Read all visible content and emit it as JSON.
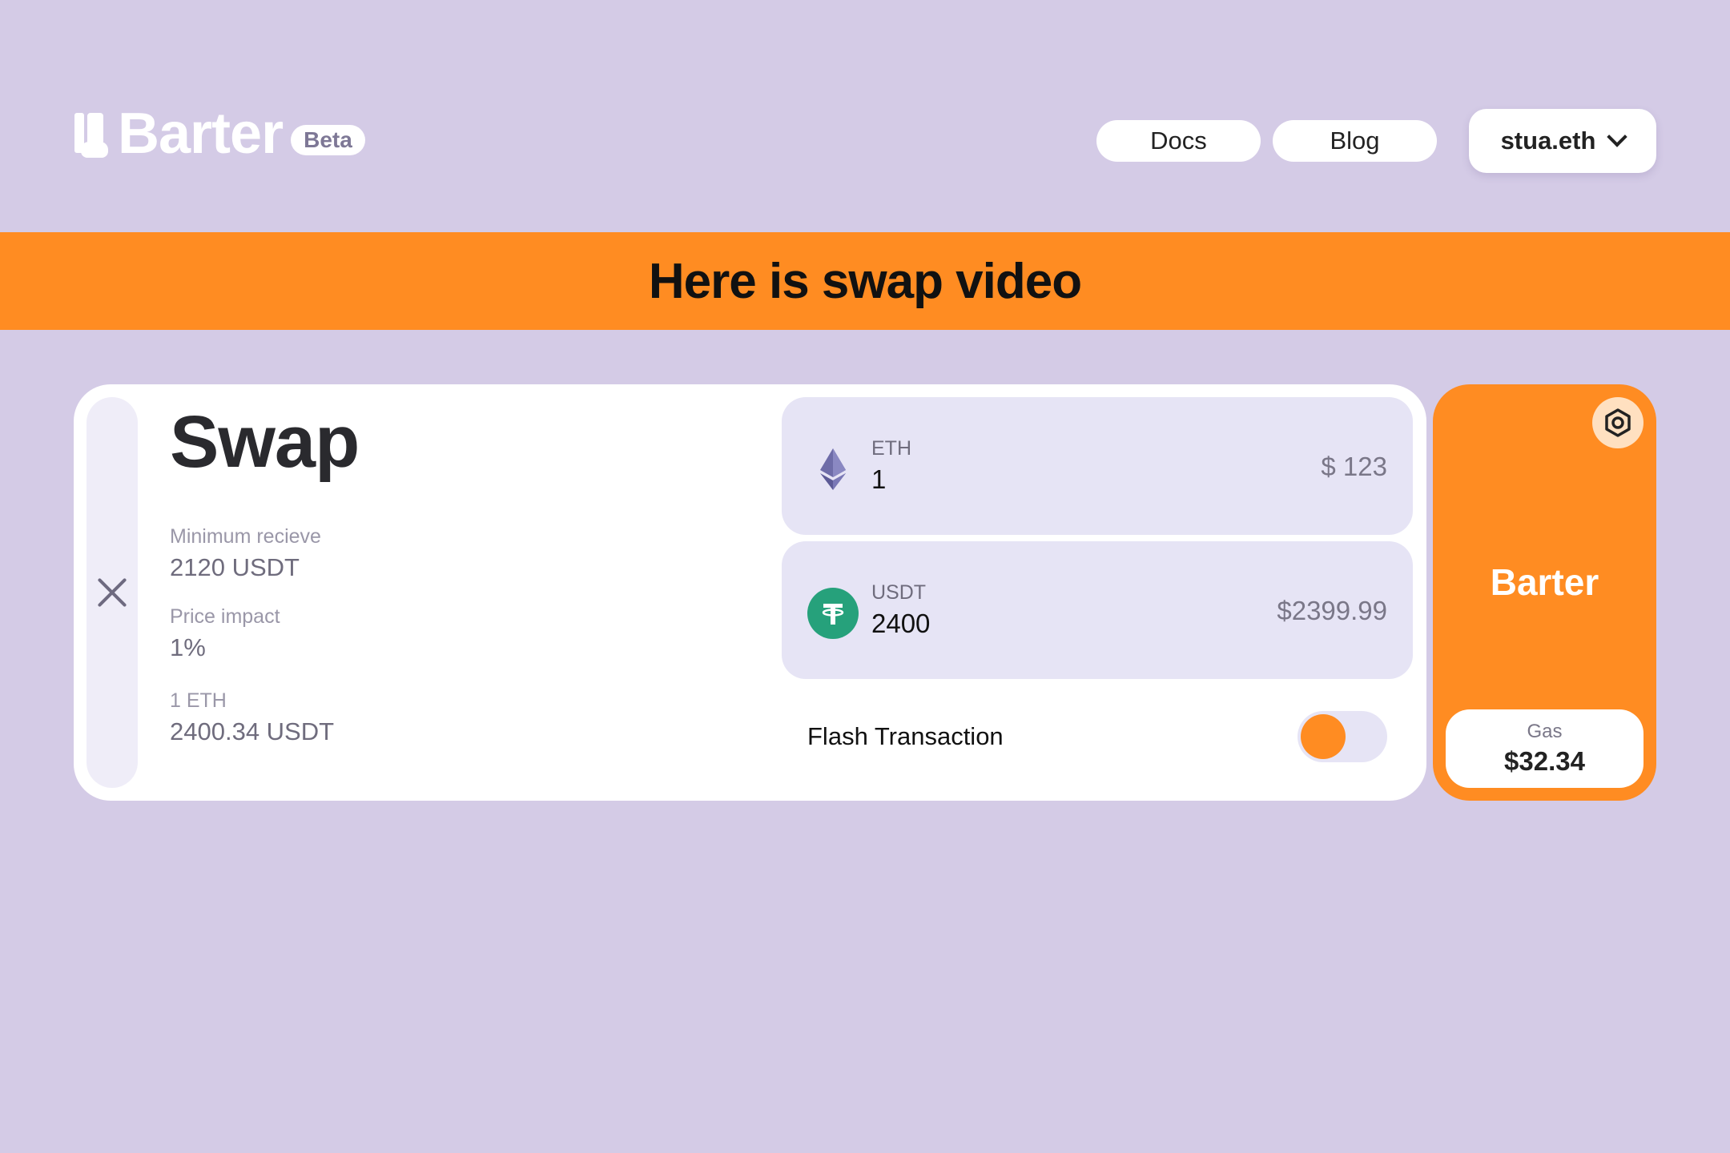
{
  "header": {
    "logo_text": "Barter",
    "beta_badge": "Beta",
    "nav": {
      "docs": "Docs",
      "blog": "Blog"
    },
    "account": "stua.eth"
  },
  "banner": {
    "title": "Here is swap video"
  },
  "swap": {
    "title": "Swap",
    "stats": [
      {
        "label": "Minimum recieve",
        "value": "2120 USDT"
      },
      {
        "label": "Price impact",
        "value": "1%"
      },
      {
        "label": "1 ETH",
        "value": "2400.34 USDT"
      }
    ],
    "from": {
      "symbol": "ETH",
      "amount": "1",
      "usd": "$ 123",
      "icon": "ethereum-icon"
    },
    "to": {
      "symbol": "USDT",
      "amount": "2400",
      "usd": "$2399.99",
      "icon": "tether-icon"
    },
    "flash": {
      "label": "Flash Transaction",
      "enabled": false
    }
  },
  "action": {
    "label": "Barter",
    "gas_label": "Gas",
    "gas_value": "$32.34"
  },
  "colors": {
    "background": "#d4cbe6",
    "accent": "#ff8c22",
    "token_box": "#e6e4f5",
    "usdt": "#26a17b"
  }
}
